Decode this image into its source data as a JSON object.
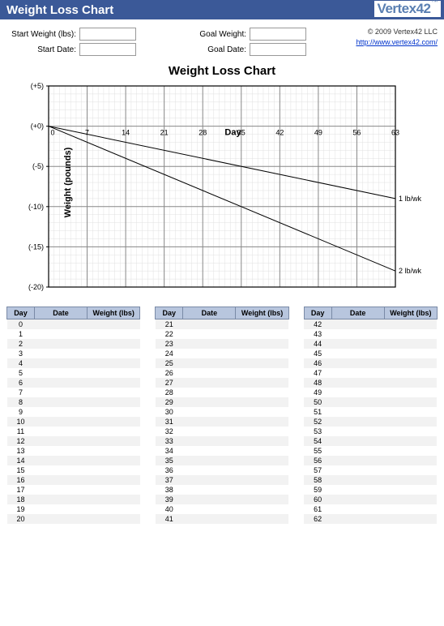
{
  "header": {
    "title": "Weight Loss Chart",
    "logo_text": "Vertex42",
    "logo_mark": "™"
  },
  "meta": {
    "start_weight_label": "Start Weight (lbs):",
    "start_date_label": "Start Date:",
    "goal_weight_label": "Goal Weight:",
    "goal_date_label": "Goal Date:",
    "start_weight_value": "",
    "start_date_value": "",
    "goal_weight_value": "",
    "goal_date_value": "",
    "copyright": "© 2009 Vertex42 LLC",
    "link_text": "http://www.vertex42.com/"
  },
  "chart_data": {
    "type": "line",
    "title": "Weight Loss Chart",
    "xlabel": "Day",
    "ylabel": "Weight (pounds)",
    "xlim": [
      0,
      63
    ],
    "ylim": [
      -20,
      5
    ],
    "x_ticks": [
      0,
      7,
      14,
      21,
      28,
      35,
      42,
      49,
      56,
      63
    ],
    "y_ticks": [
      5,
      0,
      -5,
      -10,
      -15,
      -20
    ],
    "y_tick_labels": [
      "(+5)",
      "(+0)",
      "(-5)",
      "(-10)",
      "(-15)",
      "(-20)"
    ],
    "series": [
      {
        "name": "1 lb/wk",
        "x": [
          0,
          63
        ],
        "y": [
          0,
          -9
        ]
      },
      {
        "name": "2 lb/wk",
        "x": [
          0,
          63
        ],
        "y": [
          0,
          -18
        ]
      }
    ]
  },
  "table": {
    "headers": {
      "day": "Day",
      "date": "Date",
      "weight": "Weight (lbs)"
    },
    "columns": [
      {
        "start": 0,
        "end": 20
      },
      {
        "start": 21,
        "end": 41
      },
      {
        "start": 42,
        "end": 62
      }
    ]
  }
}
